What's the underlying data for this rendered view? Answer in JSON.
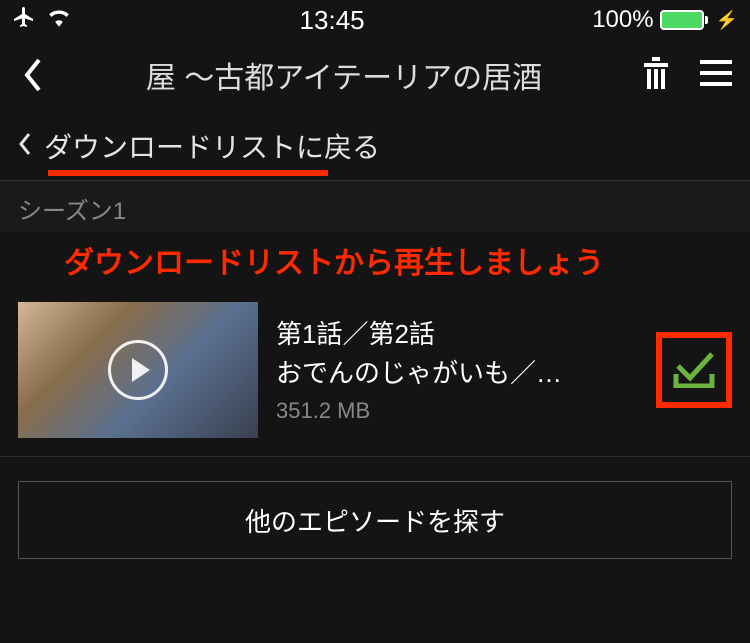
{
  "status_bar": {
    "time": "13:45",
    "battery_percent": "100%"
  },
  "nav": {
    "title": "屋 〜古都アイテーリアの居酒"
  },
  "breadcrumb": {
    "back_label": "ダウンロードリストに戻る"
  },
  "season": {
    "label": "シーズン1"
  },
  "annotation": {
    "text": "ダウンロードリストから再生しましょう"
  },
  "episode": {
    "title": "第1話／第2話",
    "subtitle": "おでんのじゃがいも／…",
    "size": "351.2 MB"
  },
  "more_button": {
    "label": "他のエピソードを探す"
  }
}
